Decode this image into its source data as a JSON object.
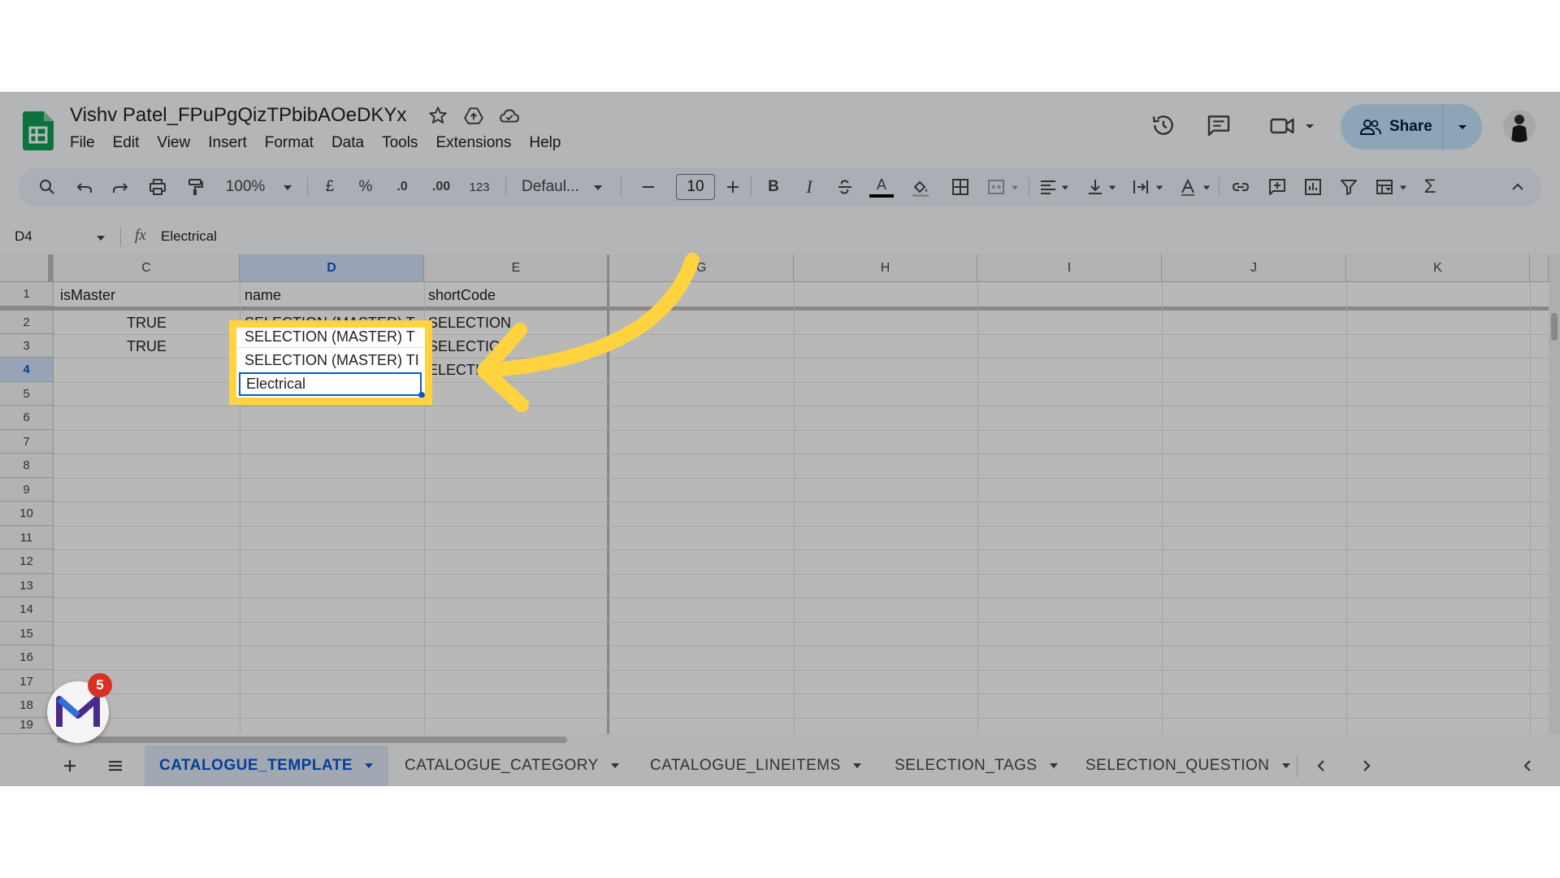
{
  "doc": {
    "title": "Vishv Patel_FPuPgQizTPbibAOeDKYx",
    "menu": [
      "File",
      "Edit",
      "View",
      "Insert",
      "Format",
      "Data",
      "Tools",
      "Extensions",
      "Help"
    ],
    "share_label": "Share"
  },
  "toolbar": {
    "zoom": "100%",
    "currency": "£",
    "percent": "%",
    "dec_decrease": ".0",
    "dec_increase": ".00",
    "number_format": "123",
    "font": "Defaul...",
    "font_size": "10",
    "bold": "B",
    "italic": "I",
    "text_color": "A",
    "sum": "Σ"
  },
  "formula_bar": {
    "cell_ref": "D4",
    "fx": "fx",
    "value": "Electrical"
  },
  "grid": {
    "columns": [
      "C",
      "D",
      "E",
      "G",
      "H",
      "I",
      "J",
      "K"
    ],
    "selected_column": "D",
    "rows": [
      "1",
      "2",
      "3",
      "4",
      "5",
      "6",
      "7",
      "8",
      "9",
      "10",
      "11",
      "12",
      "13",
      "14",
      "15",
      "16",
      "17",
      "18",
      "19"
    ],
    "selected_row": "4",
    "cells": {
      "C1": "isMaster",
      "D1": "name",
      "E1": "shortCode",
      "C2": "TRUE",
      "D2": "SELECTION (MASTER) T",
      "E2": "SELECTION",
      "C3": "TRUE",
      "D3": "SELECTION (MASTER) TI",
      "E3": "SELECTIC",
      "D4": "Electrical",
      "E4": "ELECTI"
    }
  },
  "sheet_tabs": [
    "CATALOGUE_TEMPLATE",
    "CATALOGUE_CATEGORY",
    "CATALOGUE_LINEITEMS",
    "SELECTION_TAGS",
    "SELECTION_QUESTION"
  ],
  "active_tab": "CATALOGUE_TEMPLATE",
  "extension_badge": {
    "count": "5"
  },
  "colors": {
    "accent": "#0b57d0",
    "share_bg": "#c2e7ff",
    "highlight": "#ffd23f",
    "sheets_green": "#0f9d58"
  }
}
